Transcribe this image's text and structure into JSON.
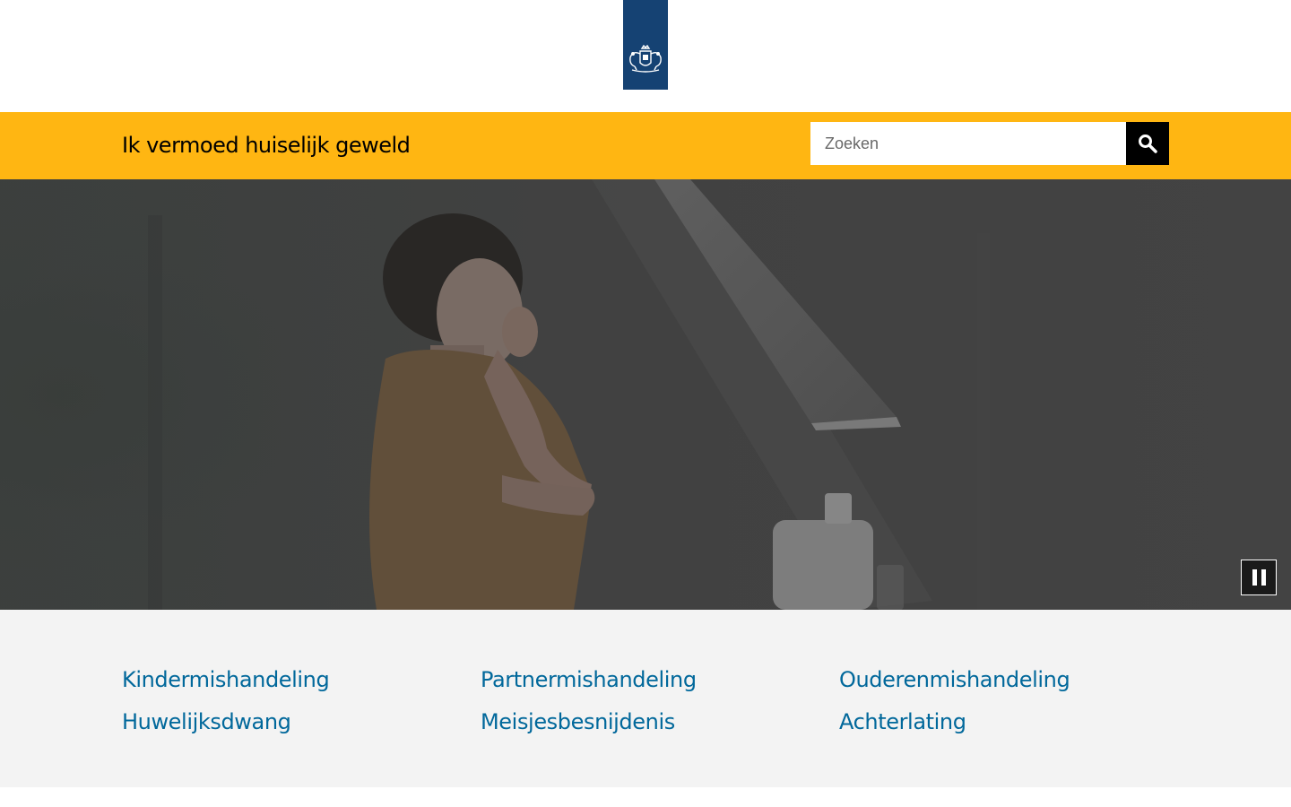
{
  "header": {
    "site_title": "Ik vermoed huiselijk geweld"
  },
  "search": {
    "placeholder": "Zoeken",
    "button_icon": "search-icon"
  },
  "hero": {
    "pause_icon": "pause-icon"
  },
  "topics": [
    "Kindermishandeling",
    "Partnermishandeling",
    "Ouderenmishandeling",
    "Huwelijksdwang",
    "Meisjesbesnijdenis",
    "Achterlating"
  ],
  "colors": {
    "brand_blue": "#154273",
    "header_yellow": "#ffb612",
    "link_blue": "#01689b",
    "topics_background": "#f3f3f3"
  }
}
